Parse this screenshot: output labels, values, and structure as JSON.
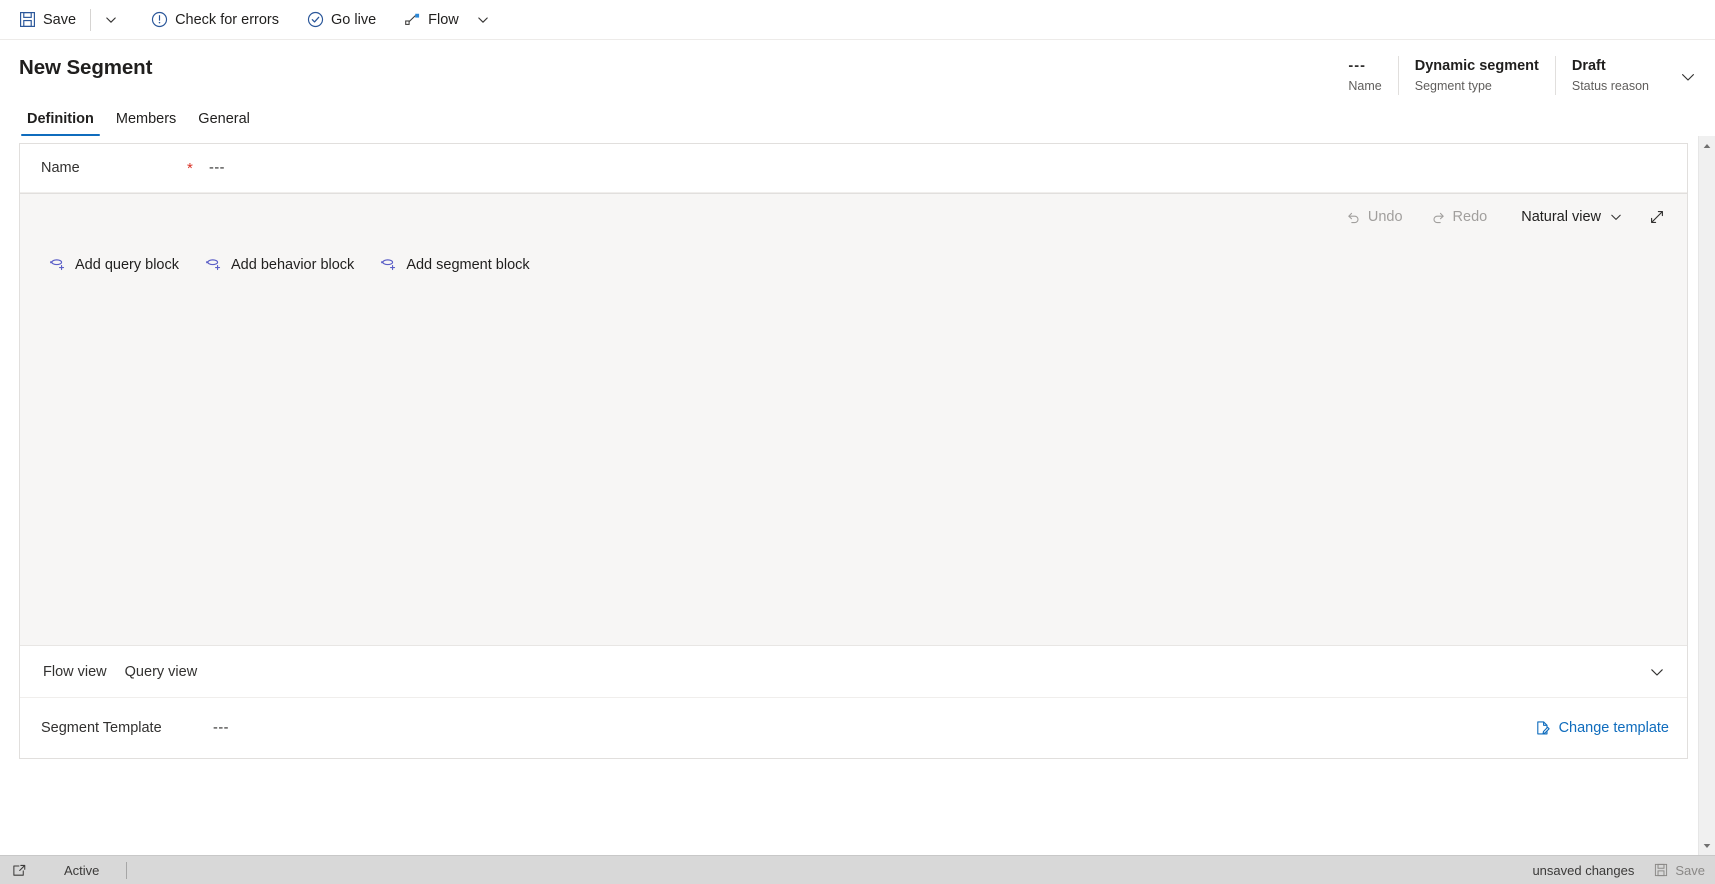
{
  "commandbar": {
    "items": [
      {
        "label": "Save",
        "icon": "save-icon"
      },
      {
        "label": "Check for errors",
        "icon": "error-circle-icon"
      },
      {
        "label": "Go live",
        "icon": "check-circle-icon"
      },
      {
        "label": "Flow",
        "icon": "flow-icon"
      }
    ],
    "save_label": "Save",
    "save_caret_name": "save-options-caret",
    "check_errors_label": "Check for errors",
    "go_live_label": "Go live",
    "flow_label": "Flow",
    "flow_caret_name": "flow-options-caret"
  },
  "header": {
    "title": "New Segment",
    "fields": [
      {
        "value": "---",
        "label": "Name"
      },
      {
        "value": "Dynamic segment",
        "label": "Segment type"
      },
      {
        "value": "Draft",
        "label": "Status reason"
      }
    ],
    "chevron_icon": "chevron-down-icon"
  },
  "tabs": [
    {
      "label": "Definition",
      "active": true
    },
    {
      "label": "Members",
      "active": false
    },
    {
      "label": "General",
      "active": false
    }
  ],
  "form": {
    "name_label": "Name",
    "name_required_marker": "*",
    "name_value": "---"
  },
  "canvas": {
    "toolbar": {
      "undo_label": "Undo",
      "redo_label": "Redo",
      "view_mode_label": "Natural view",
      "view_mode_caret": "chevron-down-icon",
      "expand_icon": "expand-diagonal-icon"
    },
    "add_blocks": [
      {
        "label": "Add query block",
        "icon": "add-query-block-icon"
      },
      {
        "label": "Add behavior block",
        "icon": "add-behavior-block-icon"
      },
      {
        "label": "Add segment block",
        "icon": "add-segment-block-icon"
      }
    ]
  },
  "view_tabs": [
    {
      "label": "Flow view"
    },
    {
      "label": "Query view"
    }
  ],
  "template": {
    "label": "Segment Template",
    "value": "---",
    "change_label": "Change template",
    "change_icon": "page-edit-icon"
  },
  "statusbar": {
    "popout_icon": "popout-icon",
    "active_label": "Active",
    "unsaved_label": "unsaved changes",
    "save_label": "Save",
    "save_icon": "save-icon"
  },
  "colors": {
    "accent": "#0f6cbd",
    "required": "#d93025",
    "link": "#0f6cbd",
    "canvas_bg": "#f7f6f5",
    "statusbar_bg": "#d8d8d8"
  }
}
